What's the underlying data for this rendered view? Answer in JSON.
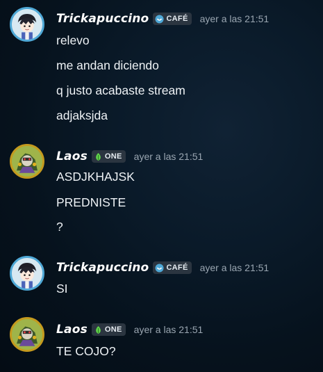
{
  "messages": [
    {
      "author": "Trickapuccino",
      "tag": "CAFÉ",
      "tag_color": "#4fa8d6",
      "timestamp": "ayer a las 21:51",
      "lines": [
        "relevo",
        "me andan diciendo",
        "q justo acabaste stream",
        "adjaksjda"
      ]
    },
    {
      "author": "Laos",
      "tag": "ONE",
      "tag_color": "#5fd14a",
      "timestamp": "ayer a las 21:51",
      "lines": [
        "ASDJKHAJSK",
        "PREDNISTE",
        "?"
      ]
    },
    {
      "author": "Trickapuccino",
      "tag": "CAFÉ",
      "tag_color": "#4fa8d6",
      "timestamp": "ayer a las 21:51",
      "lines": [
        "SI"
      ]
    },
    {
      "author": "Laos",
      "tag": "ONE",
      "tag_color": "#5fd14a",
      "timestamp": "ayer a las 21:51",
      "lines": [
        "TE COJO?"
      ]
    }
  ]
}
